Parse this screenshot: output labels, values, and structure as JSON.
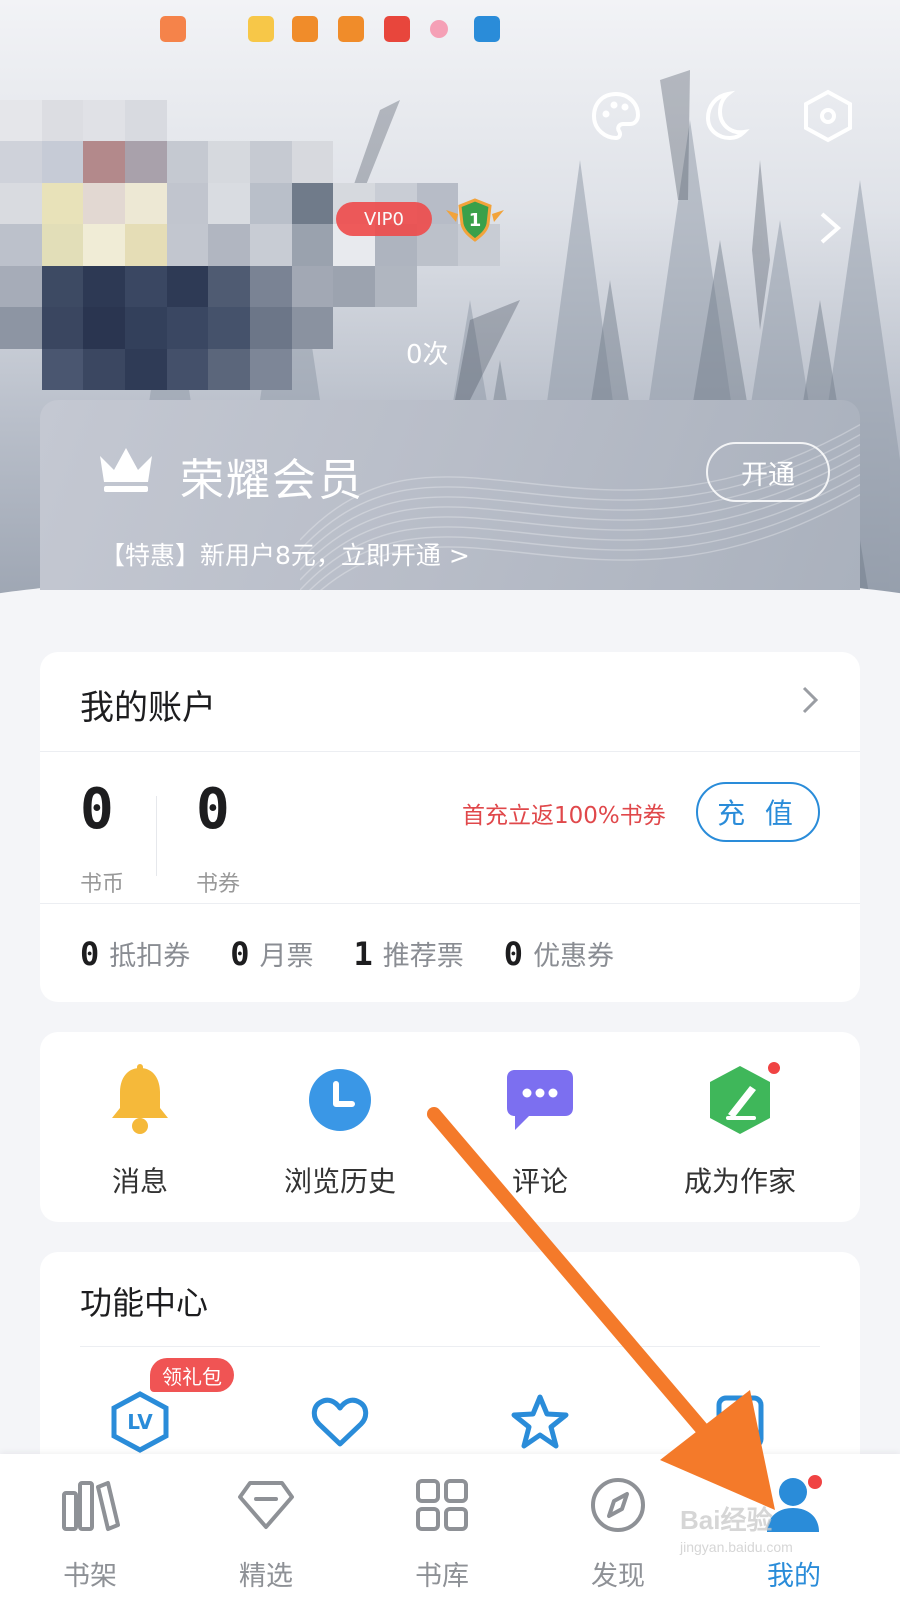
{
  "vip": {
    "title": "荣耀会员",
    "open_label": "开通",
    "promo": "【特惠】新用户8元，立即开通 >"
  },
  "profile": {
    "badge_text": "VIP0",
    "level": "1",
    "read_count_suffix": "0次"
  },
  "account": {
    "title": "我的账户",
    "coins": {
      "value": "0",
      "label": "书币"
    },
    "vouchers": {
      "value": "0",
      "label": "书券"
    },
    "recharge_promo": "首充立返100%书券",
    "recharge_label": "充 值",
    "tickets": [
      {
        "value": "0",
        "label": "抵扣券"
      },
      {
        "value": "0",
        "label": "月票"
      },
      {
        "value": "1",
        "label": "推荐票"
      },
      {
        "value": "0",
        "label": "优惠券"
      }
    ]
  },
  "quick_actions": [
    {
      "label": "消息",
      "icon": "bell-icon"
    },
    {
      "label": "浏览历史",
      "icon": "clock-icon"
    },
    {
      "label": "评论",
      "icon": "chat-bubble-icon"
    },
    {
      "label": "成为作家",
      "icon": "pen-icon"
    }
  ],
  "function_center": {
    "title": "功能中心",
    "gift_badge": "领礼包",
    "items": [
      "level-badge-icon",
      "heart-icon",
      "star-icon",
      "document-icon"
    ]
  },
  "bottom_nav": [
    {
      "label": "书架",
      "icon": "bookshelf-icon"
    },
    {
      "label": "精选",
      "icon": "diamond-icon"
    },
    {
      "label": "书库",
      "icon": "grid-icon"
    },
    {
      "label": "发现",
      "icon": "compass-icon"
    },
    {
      "label": "我的",
      "icon": "user-icon",
      "active": true
    }
  ],
  "watermark": {
    "brand": "Bai经验",
    "url": "jingyan.baidu.com"
  },
  "colors": {
    "accent": "#2a8cd9",
    "promo_red": "#e0484b",
    "annotation": "#f47a2a"
  }
}
